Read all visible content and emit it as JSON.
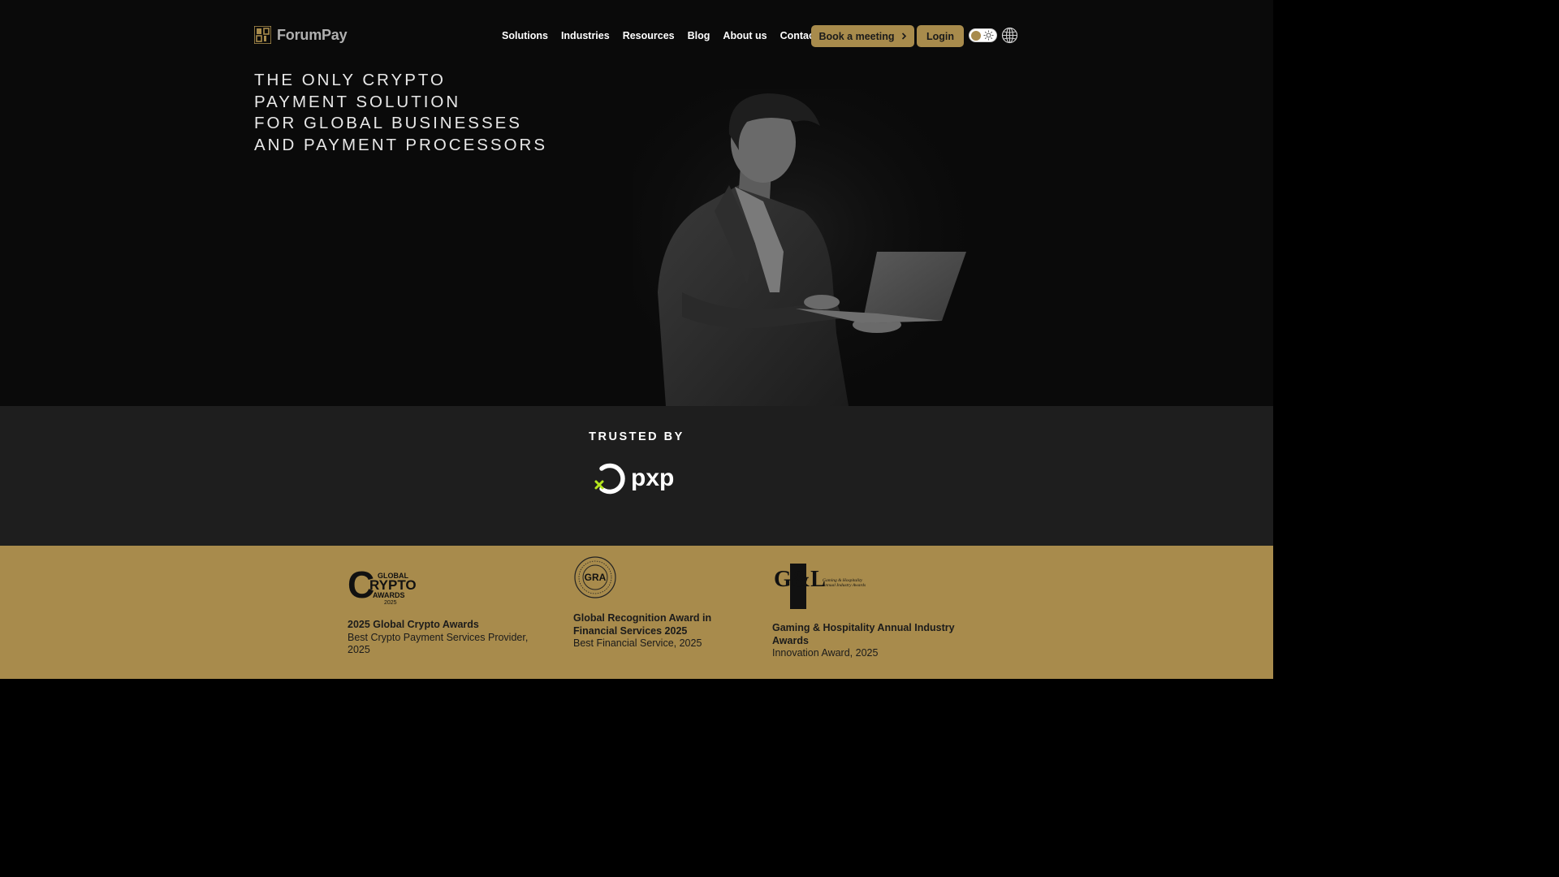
{
  "header": {
    "brand": "ForumPay",
    "nav": [
      "Solutions",
      "Industries",
      "Resources",
      "Blog",
      "About us",
      "Contact us"
    ],
    "book_meeting": "Book a meeting",
    "login": "Login",
    "theme_toggle_icon": "sun-icon",
    "language_icon": "globe-icon"
  },
  "hero": {
    "headline_lines": [
      "THE ONLY CRYPTO",
      "PAYMENT SOLUTION",
      "FOR GLOBAL BUSINESSES",
      "AND PAYMENT PROCESSORS"
    ]
  },
  "trusted": {
    "title": "TRUSTED BY",
    "partner": "pxp"
  },
  "awards": [
    {
      "logo": {
        "line1": "GLOBAL",
        "big_letter": "C",
        "word": "RYPTO",
        "line2": "AWARDS",
        "year": "2025"
      },
      "name": "2025 Global Crypto Awards",
      "desc": "Best Crypto Payment Services Provider, 2025"
    },
    {
      "logo": {
        "text": "GRA"
      },
      "name": "Global Recognition Award in Financial Services 2025",
      "desc": "Best Financial Service, 2025"
    },
    {
      "logo": {
        "text": "G&L",
        "subtitle": "Gaming & Hospitality Annual Industry Awards"
      },
      "name": "Gaming & Hospitality Annual Industry Awards",
      "desc": "Innovation Award, 2025"
    }
  ],
  "colors": {
    "accent": "#a88b4c",
    "hero_bg": "#0a0a0a",
    "trusted_bg": "#1e1e1e",
    "pxp_dot": "#b5e61d"
  }
}
